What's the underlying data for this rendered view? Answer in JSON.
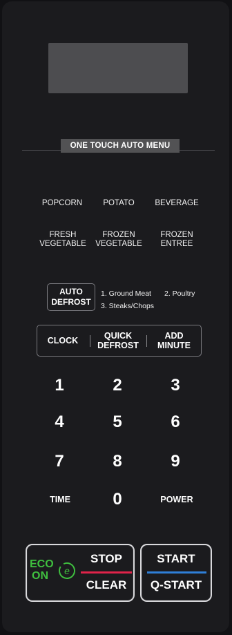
{
  "menu": {
    "title": "ONE TOUCH AUTO MENU",
    "row1": [
      "POPCORN",
      "POTATO",
      "BEVERAGE"
    ],
    "row2": [
      [
        "FRESH",
        "VEGETABLE"
      ],
      [
        "FROZEN",
        "VEGETABLE"
      ],
      [
        "FROZEN",
        "ENTREE"
      ]
    ]
  },
  "auto_defrost": {
    "label": [
      "AUTO",
      "DEFROST"
    ],
    "option1": "1. Ground Meat",
    "option2": "2. Poultry",
    "option3": "3. Steaks/Chops"
  },
  "function_row": {
    "clock": "CLOCK",
    "quick_defrost": [
      "QUICK",
      "DEFROST"
    ],
    "add_minute": [
      "ADD",
      "MINUTE"
    ]
  },
  "keypad": {
    "digits": [
      "1",
      "2",
      "3",
      "4",
      "5",
      "6",
      "7",
      "8",
      "9"
    ],
    "time": "TIME",
    "zero": "0",
    "power": "POWER"
  },
  "eco": {
    "line1": "ECO",
    "line2": "ON",
    "icon": "eco-leaf-icon"
  },
  "stop_clear": {
    "top": "STOP",
    "bottom": "CLEAR"
  },
  "start": {
    "top": "START",
    "bottom": "Q-START"
  },
  "colors": {
    "eco_green": "#3fbf3f",
    "stop_red": "#e0234a",
    "start_blue": "#2f7fd8",
    "panel": "#1b1b1e",
    "display": "#4d4d50"
  }
}
